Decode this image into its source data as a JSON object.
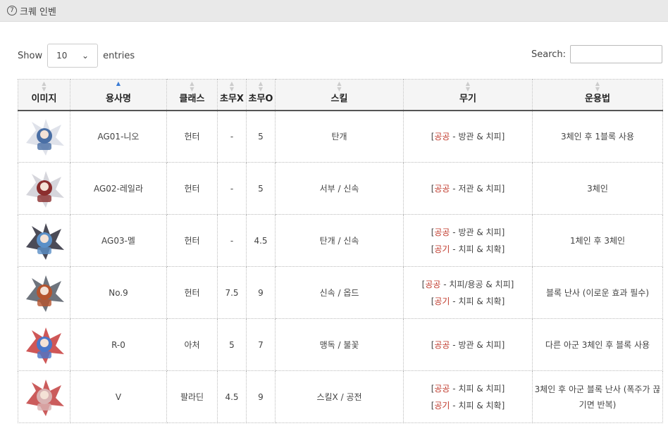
{
  "header": {
    "title": "크퀘 인벤",
    "badge": "7"
  },
  "length_control": {
    "show": "Show",
    "value": "10",
    "entries": "entries"
  },
  "search": {
    "label": "Search:",
    "placeholder": ""
  },
  "table": {
    "columns": [
      "이미지",
      "용사명",
      "클래스",
      "초무X",
      "초무O",
      "스킬",
      "무기",
      "운용법"
    ],
    "rows": [
      {
        "name": "AG01-니오",
        "class": "헌터",
        "x": "-",
        "o": "5",
        "skill": "탄개",
        "weapon": [
          {
            "open": "[",
            "tag": "공공",
            "rest": " - 방관 & 치피]"
          }
        ],
        "usage": "3체인 후 1블록 사용"
      },
      {
        "name": "AG02-레일라",
        "class": "헌터",
        "x": "-",
        "o": "5",
        "skill": "서부 / 신속",
        "weapon": [
          {
            "open": "[",
            "tag": "공공",
            "rest": " - 저관 & 치피]"
          }
        ],
        "usage": "3체인"
      },
      {
        "name": "AG03-멜",
        "class": "헌터",
        "x": "-",
        "o": "4.5",
        "skill": "탄개 / 신속",
        "weapon": [
          {
            "open": "[",
            "tag": "공공",
            "rest": " - 방관 & 치피]"
          },
          {
            "open": "[",
            "tag": "공기",
            "rest": " - 치피 & 치확]"
          }
        ],
        "usage": "1체인 후 3체인"
      },
      {
        "name": "No.9",
        "class": "헌터",
        "x": "7.5",
        "o": "9",
        "skill": "신속 / 옵드",
        "weapon": [
          {
            "open": "[",
            "tag": "공공",
            "rest": " - 치피/용공 & 치피]"
          },
          {
            "open": "[",
            "tag": "공기",
            "rest": " - 치피 & 치확]"
          }
        ],
        "usage": "블록 난사 (이로운 효과 필수)"
      },
      {
        "name": "R-0",
        "class": "아처",
        "x": "5",
        "o": "7",
        "skill": "맹독 / 불꽃",
        "weapon": [
          {
            "open": "[",
            "tag": "공공",
            "rest": " - 방관 & 치피]"
          }
        ],
        "usage": "다른 아군 3체인 후 블록 사용"
      },
      {
        "name": "V",
        "class": "팔라딘",
        "x": "4.5",
        "o": "9",
        "skill": "스킬X / 공전",
        "weapon": [
          {
            "open": "[",
            "tag": "공공",
            "rest": " - 치피 & 치피]"
          },
          {
            "open": "[",
            "tag": "공기",
            "rest": " - 치피 & 치확]"
          }
        ],
        "usage": "3체인 후 아군 블록 난사 (폭주가 끊기면 반복)"
      }
    ]
  },
  "colors": {
    "accent": "#3a7bd5",
    "weapon_tag": "#c0392b"
  }
}
